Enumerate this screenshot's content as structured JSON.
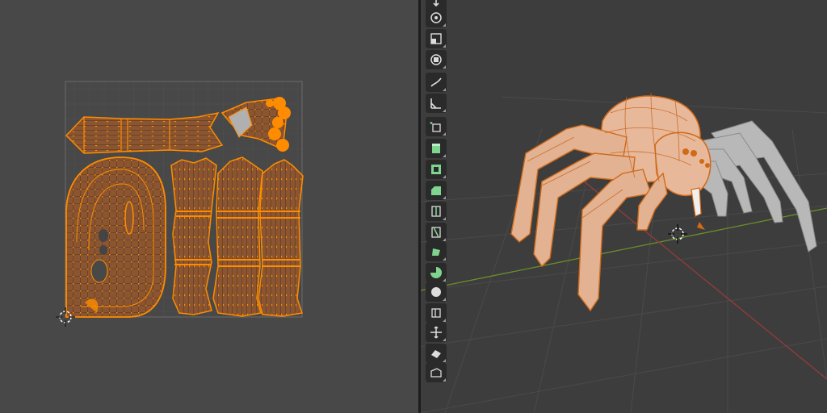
{
  "colors": {
    "uv_background": "#484848",
    "viewport_background": "#3d3d3d",
    "selection_orange": "#ff8c00",
    "mesh_fill": "#8a5530",
    "x_axis": "#9a3a3a",
    "y_axis": "#6a8f2a",
    "toolbar_button": "#2a2a2a",
    "icon_green": "#7fd48f"
  },
  "uv_editor": {
    "islands": [
      "leg-strip-top",
      "fang-island",
      "body-island",
      "leg-column-1",
      "leg-column-2",
      "leg-column-3"
    ],
    "cursor": "2d-cursor"
  },
  "viewport": {
    "object": "spider-mesh",
    "mode": "edit-mode",
    "cursor": "3d-cursor"
  },
  "toolbar": {
    "tools": [
      {
        "name": "move-tool",
        "icon": "move-down-icon"
      },
      {
        "name": "rotate-tool",
        "icon": "rotate-icon"
      },
      {
        "name": "scale-tool",
        "icon": "scale-icon"
      },
      {
        "name": "transform-tool",
        "icon": "transform-icon"
      },
      {
        "name": "annotate-tool",
        "icon": "annotate-pen-icon"
      },
      {
        "name": "measure-tool",
        "icon": "ruler-icon"
      },
      {
        "name": "add-cube-tool",
        "icon": "add-cube-icon"
      },
      {
        "name": "extrude-tool",
        "icon": "extrude-icon"
      },
      {
        "name": "inset-tool",
        "icon": "inset-icon"
      },
      {
        "name": "bevel-tool",
        "icon": "bevel-icon"
      },
      {
        "name": "loop-cut-tool",
        "icon": "loop-cut-icon"
      },
      {
        "name": "knife-tool",
        "icon": "knife-icon"
      },
      {
        "name": "poly-build-tool",
        "icon": "poly-build-icon"
      },
      {
        "name": "spin-tool",
        "icon": "spin-icon"
      },
      {
        "name": "smooth-tool",
        "icon": "smooth-icon"
      },
      {
        "name": "edge-slide-tool",
        "icon": "edge-slide-icon"
      },
      {
        "name": "shrink-fatten-tool",
        "icon": "shrink-fatten-icon"
      },
      {
        "name": "shear-tool",
        "icon": "shear-icon"
      },
      {
        "name": "rip-region-tool",
        "icon": "rip-icon"
      }
    ]
  }
}
